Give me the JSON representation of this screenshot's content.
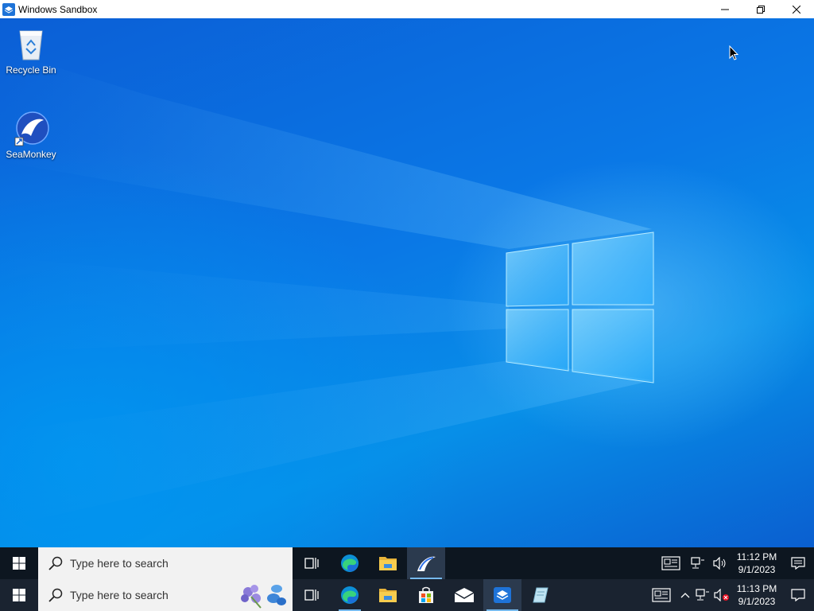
{
  "window": {
    "title": "Windows Sandbox",
    "minimize_glyph": "—",
    "restore_glyph": "❐",
    "close_glyph": "✕"
  },
  "desktop": {
    "icons": [
      {
        "label": "Recycle Bin",
        "icon": "recycle-bin-icon"
      },
      {
        "label": "SeaMonkey",
        "icon": "seamonkey-icon"
      }
    ]
  },
  "inner_taskbar": {
    "search_placeholder": "Type here to search",
    "apps": [
      "task-view-icon",
      "edge-icon",
      "file-explorer-icon",
      "seamonkey-icon"
    ],
    "time": "11:12 PM",
    "date": "9/1/2023"
  },
  "outer_taskbar": {
    "search_placeholder": "Type here to search",
    "apps": [
      "task-view-icon",
      "edge-icon",
      "file-explorer-icon",
      "store-icon",
      "mail-icon",
      "windows-sandbox-icon",
      "notepad-icon"
    ],
    "time": "11:13 PM",
    "date": "9/1/2023"
  },
  "colors": {
    "accent": "#76b9ed",
    "desktop_blue": "#0a78e6",
    "taskbar": "#101721"
  }
}
